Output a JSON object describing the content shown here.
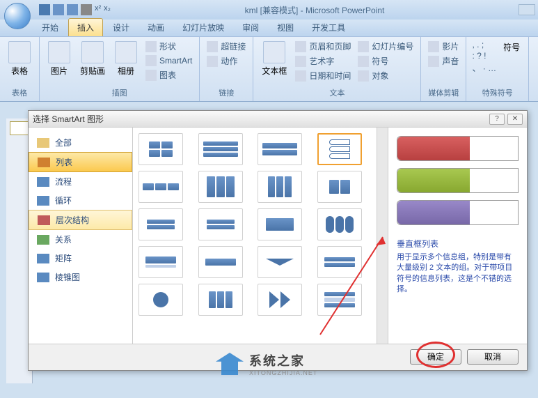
{
  "window": {
    "title": "kml [兼容模式] - Microsoft PowerPoint"
  },
  "tabs": [
    "开始",
    "插入",
    "设计",
    "动画",
    "幻灯片放映",
    "审阅",
    "视图",
    "开发工具"
  ],
  "active_tab": 1,
  "ribbon": {
    "groups": [
      {
        "label": "表格",
        "items": [
          {
            "label": "表格"
          }
        ]
      },
      {
        "label": "插图",
        "items": [
          {
            "label": "图片"
          },
          {
            "label": "剪贴画"
          },
          {
            "label": "相册"
          }
        ],
        "side": [
          {
            "label": "形状"
          },
          {
            "label": "SmartArt"
          },
          {
            "label": "图表"
          }
        ]
      },
      {
        "label": "链接",
        "side": [
          {
            "label": "超链接"
          },
          {
            "label": "动作"
          }
        ]
      },
      {
        "label": "文本",
        "items": [
          {
            "label": "文本框"
          }
        ],
        "side": [
          {
            "label": "页眉和页脚"
          },
          {
            "label": "艺术字"
          },
          {
            "label": "日期和时间"
          }
        ],
        "side2": [
          {
            "label": "幻灯片编号"
          },
          {
            "label": "符号"
          },
          {
            "label": "对象"
          }
        ]
      },
      {
        "label": "媒体剪辑",
        "side": [
          {
            "label": "影片"
          },
          {
            "label": "声音"
          }
        ]
      },
      {
        "label": "特殊符号",
        "items": [
          {
            "label": "符号"
          }
        ],
        "chars": [
          ",",
          ".",
          ";",
          ":",
          "?",
          "!",
          "、",
          "·",
          "…"
        ]
      }
    ]
  },
  "dialog": {
    "title": "选择 SmartArt 图形",
    "categories": [
      "全部",
      "列表",
      "流程",
      "循环",
      "层次结构",
      "关系",
      "矩阵",
      "棱锥图"
    ],
    "selected_category": 1,
    "hover_category": 4,
    "preview": {
      "title": "垂直框列表",
      "description": "用于显示多个信息组，特别是带有大量级别 2 文本的组。对于带项目符号的信息列表，这是个不错的选择。"
    },
    "buttons": {
      "ok": "确定",
      "cancel": "取消"
    },
    "help": "?",
    "close": "✕"
  },
  "watermark": {
    "cn": "系统之家",
    "en": "XITONGZHIJIA.NET"
  }
}
